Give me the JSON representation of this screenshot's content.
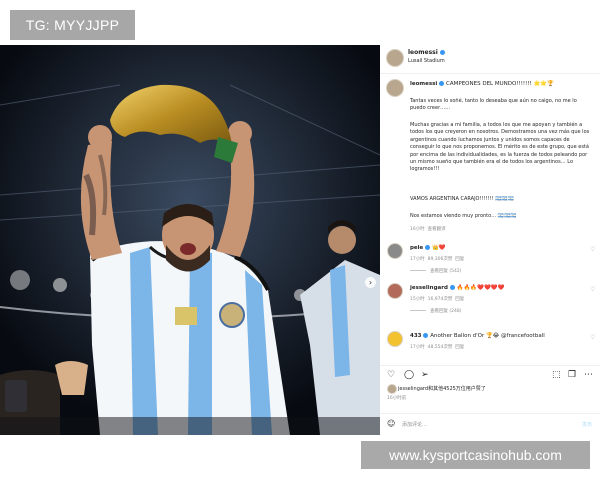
{
  "watermark_top": "TG: MYYJJPP",
  "watermark_bottom": "www.kysportcasinohub.com",
  "header": {
    "username": "leomessi",
    "location": "Lusail Stadium"
  },
  "caption": {
    "username": "leomessi",
    "title": "CAMPEONES DEL MUNDO!!!!!!! 🌟🌟🏆",
    "paragraphs": [
      "Tantas veces lo soñé, tanto lo deseaba que aún no caigo, no me lo puedo creer……",
      "Muchas gracias a mi familia, a todos los que me apoyan y también a todos los que creyeron en nosotros. Demostramos una vez más que los argentinos cuando luchamos juntos y unidos somos capaces de conseguir lo que nos proponemos. El mérito es de este grupo, que está por encima de las individualidades, es la fuerza de todos peleando por un mismo sueño que también era el de todos los argentinos… Lo logramos!!!",
      "VAMOS ARGENTINA CARAJO!!!!!!! 🇦🇷🇦🇷🇦🇷",
      "Nos estamos viendo muy pronto… 🇦🇷🇦🇷🇦🇷"
    ],
    "time": "16小时",
    "translate": "查看翻译"
  },
  "comments": [
    {
      "user": "pele",
      "text": "👑❤️",
      "time": "17小时",
      "likes": "89,306次赞",
      "reply": "回复",
      "replies_label": "查看回复 (542)"
    },
    {
      "user": "jesselingard",
      "text": "🔥🔥🔥❤️❤️❤️❤️",
      "time": "15小时",
      "likes": "16,974次赞",
      "reply": "回复",
      "replies_label": "查看回复 (248)"
    },
    {
      "user": "433",
      "text": "Another Ballon d'Or 🏆😂 @francefootball",
      "time": "17小时",
      "likes": "48,554次赞",
      "reply": "回复",
      "replies_label": ""
    }
  ],
  "actions": {
    "liked_by": "jesselingard和其他4525万位用户赞了",
    "time_ago": "16小时前"
  },
  "comment_bar": {
    "placeholder": "添加评论…",
    "post": "发布"
  },
  "colors": {
    "verified": "#3897f0",
    "heart": "#ed4956",
    "kit_blue": "#7cb6e8"
  },
  "icons": [
    "verified-badge-icon",
    "heart-icon",
    "comment-icon",
    "share-icon",
    "bookmark-icon",
    "smile-icon",
    "more-icon",
    "chevron-right-icon"
  ]
}
